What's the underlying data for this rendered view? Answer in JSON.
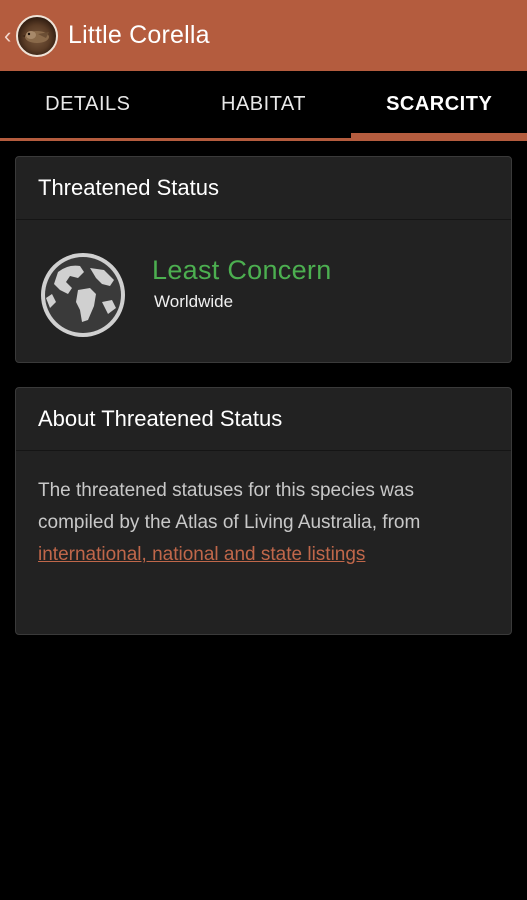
{
  "action_bar": {
    "title": "Little Corella",
    "up_icon": "chevron-left-icon",
    "app_icon": "bird-logo-icon",
    "background_color": "#b45c3e"
  },
  "tabs": [
    {
      "label": "DETAILS",
      "active": false
    },
    {
      "label": "HABITAT",
      "active": false
    },
    {
      "label": "SCARCITY",
      "active": true
    }
  ],
  "threatened_card": {
    "title": "Threatened Status",
    "icon": "globe-icon",
    "status": "Least Concern",
    "status_color": "#4caf50",
    "scope": "Worldwide"
  },
  "about_card": {
    "title": "About Threatened Status",
    "body": "The threatened statuses for this species was compiled by the Atlas of Living Australia, from ",
    "link_text": "international, national and state listings",
    "link_color": "#c0674a"
  }
}
